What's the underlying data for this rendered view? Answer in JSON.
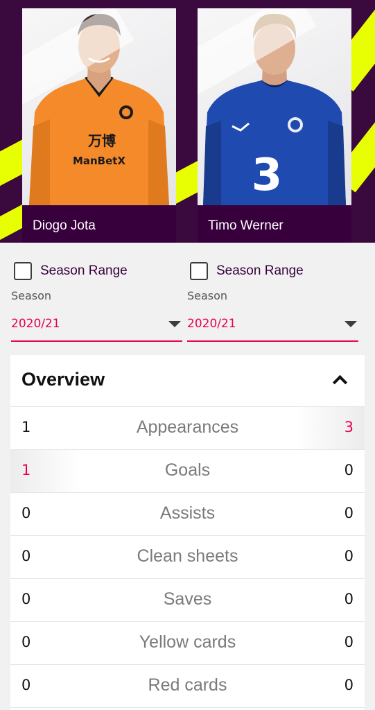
{
  "players": [
    {
      "name": "Diogo Jota",
      "shirt_color": "#f58a2a",
      "sponsor": "ManBetX",
      "sponsor_cn": "万博"
    },
    {
      "name": "Timo Werner",
      "shirt_color": "#1f4bb0",
      "sponsor": "3"
    }
  ],
  "filters": [
    {
      "range_label": "Season Range",
      "season_label": "Season",
      "season_value": "2020/21"
    },
    {
      "range_label": "Season Range",
      "season_label": "Season",
      "season_value": "2020/21"
    }
  ],
  "overview": {
    "title": "Overview",
    "stats": [
      {
        "label": "Appearances",
        "left": "1",
        "right": "3",
        "leader": "right"
      },
      {
        "label": "Goals",
        "left": "1",
        "right": "0",
        "leader": "left"
      },
      {
        "label": "Assists",
        "left": "0",
        "right": "0",
        "leader": "none"
      },
      {
        "label": "Clean sheets",
        "left": "0",
        "right": "0",
        "leader": "none"
      },
      {
        "label": "Saves",
        "left": "0",
        "right": "0",
        "leader": "none"
      },
      {
        "label": "Yellow cards",
        "left": "0",
        "right": "0",
        "leader": "none"
      },
      {
        "label": "Red cards",
        "left": "0",
        "right": "0",
        "leader": "none"
      }
    ]
  },
  "colors": {
    "brand_purple": "#37003c",
    "accent_pink": "#e90052",
    "accent_lime": "#e7ff02"
  }
}
